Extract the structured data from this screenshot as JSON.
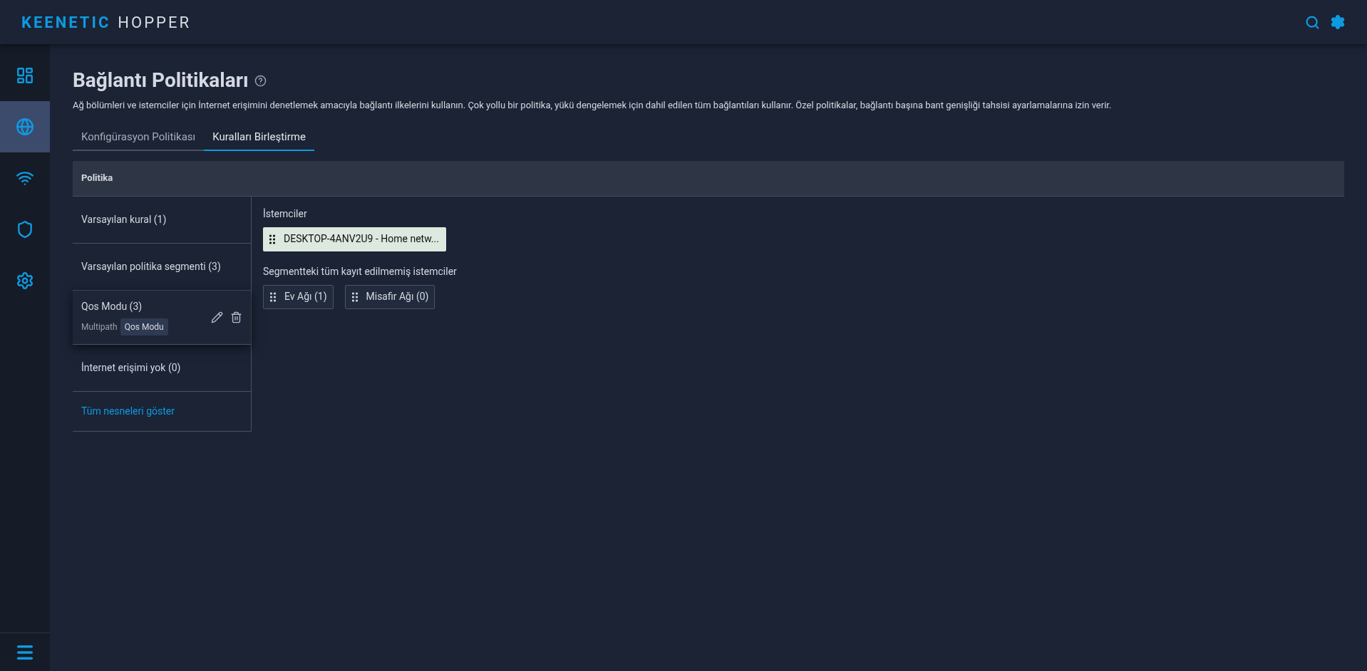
{
  "header": {
    "logo_primary": "KEENETIC",
    "logo_secondary": "HOPPER"
  },
  "sidebar": {
    "items": [
      {
        "kind": "dashboard",
        "selected": false
      },
      {
        "kind": "internet",
        "selected": true
      },
      {
        "kind": "wireless",
        "selected": false
      },
      {
        "kind": "security",
        "selected": false
      },
      {
        "kind": "settings",
        "selected": false
      }
    ]
  },
  "page": {
    "title": "Bağlantı Politikaları",
    "description": "Ağ bölümleri ve istemciler için İnternet erişimini denetlemek amacıyla bağlantı ilkelerini kullanın. Çok yollu bir politika, yükü dengelemek için dahil edilen tüm bağlantıları kullanır. Özel politikalar, bağlantı başına bant genişliği tahsisi ayarlamalarına izin verir."
  },
  "tabs": [
    {
      "label": "Konfigürasyon Politikası",
      "selected": false
    },
    {
      "label": "Kuralları Birleştirme",
      "selected": true
    }
  ],
  "table": {
    "header": "Politika",
    "policies": [
      {
        "label": "Varsayılan kural (1)",
        "hovered": false
      },
      {
        "label": "Varsayılan politika segmenti (3)",
        "hovered": false
      },
      {
        "label": "Qos Modu (3)",
        "hovered": true,
        "subtitle": "Multipath",
        "tooltip": "Qos Modu"
      },
      {
        "label": "İnternet erişimi yok (0)",
        "hovered": false
      }
    ],
    "show_all_link": "Tüm nesneleri göster",
    "clients_title": "İstemciler",
    "clients": [
      "DESKTOP-4ANV2U9 - Home netw..."
    ],
    "segments_title": "Segmentteki tüm kayıt edilmemiş istemciler",
    "segments": [
      "Ev Ağı (1)",
      "Misafir Ağı (0)"
    ]
  }
}
